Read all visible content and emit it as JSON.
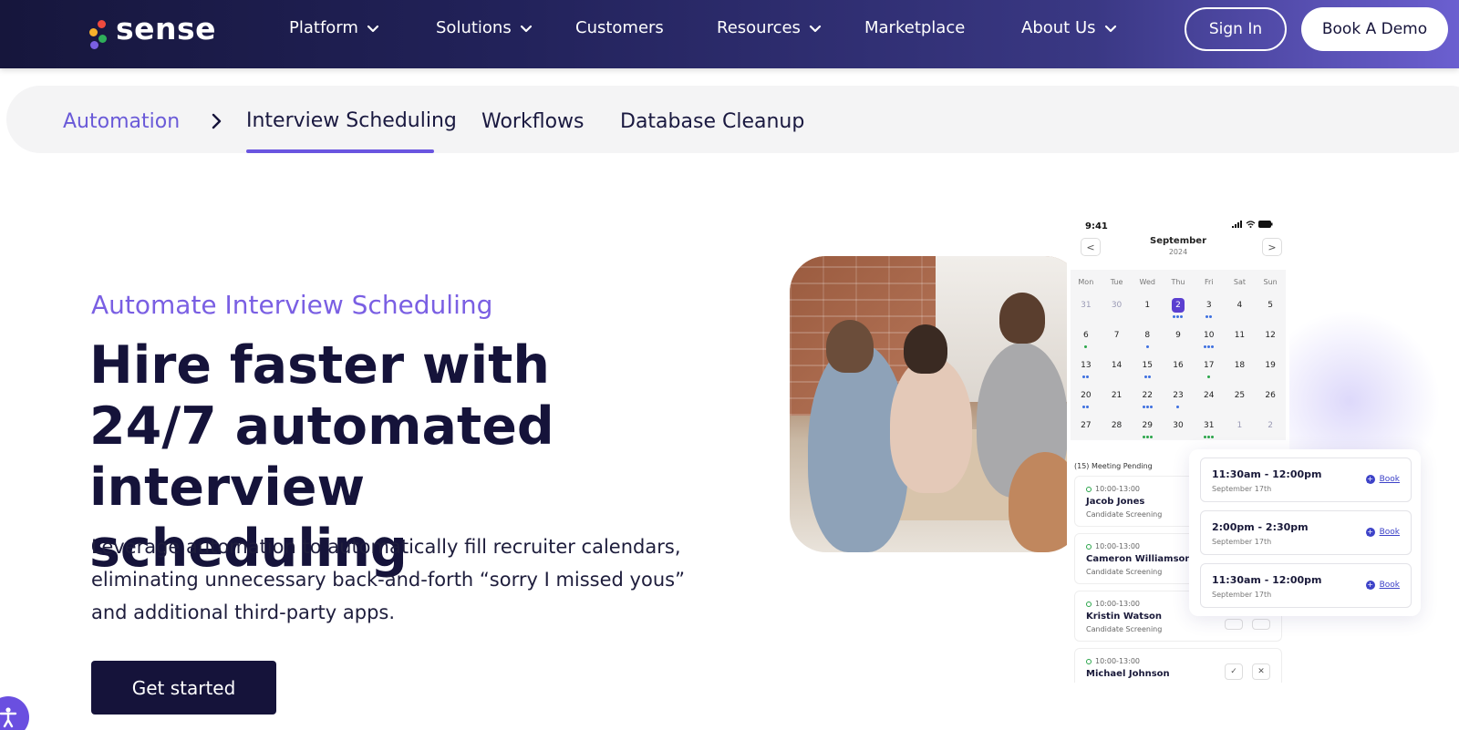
{
  "brand": {
    "name": "sense",
    "dot_colors": [
      "#f04a3e",
      "#f6b12b",
      "#2fae5a",
      "#7a5fe3"
    ]
  },
  "nav": {
    "items": [
      {
        "label": "Platform",
        "has_dropdown": true
      },
      {
        "label": "Solutions",
        "has_dropdown": true
      },
      {
        "label": "Customers",
        "has_dropdown": false
      },
      {
        "label": "Resources",
        "has_dropdown": true
      },
      {
        "label": "Marketplace",
        "has_dropdown": false
      },
      {
        "label": "About Us",
        "has_dropdown": true
      }
    ],
    "sign_in": "Sign In",
    "book_demo": "Book A Demo"
  },
  "subnav": {
    "root": "Automation",
    "items": [
      "Interview Scheduling",
      "Workflows",
      "Database Cleanup"
    ],
    "active_index": 0
  },
  "hero": {
    "eyebrow": "Automate Interview Scheduling",
    "title": "Hire faster with 24/7 automated interview scheduling",
    "description": "Leverage automation to automatically fill recruiter calendars, eliminating unnecessary back-and-forth “sorry I missed yous” and additional third-party apps.",
    "cta": "Get started"
  },
  "phone": {
    "time": "9:41",
    "month": "September",
    "year": "2024",
    "prev": "<",
    "next": ">",
    "weekdays": [
      "Mon",
      "Tue",
      "Wed",
      "Thu",
      "Fri",
      "Sat",
      "Sun"
    ],
    "weeks": [
      [
        "31",
        "30",
        "1",
        "2",
        "3",
        "4",
        "5"
      ],
      [
        "6",
        "7",
        "8",
        "9",
        "10",
        "11",
        "12"
      ],
      [
        "13",
        "14",
        "15",
        "16",
        "17",
        "18",
        "19"
      ],
      [
        "20",
        "21",
        "22",
        "23",
        "24",
        "25",
        "26"
      ],
      [
        "27",
        "28",
        "29",
        "30",
        "31",
        "1",
        "2"
      ]
    ],
    "selected_day": "2",
    "pending_label": "(15) Meeting Pending",
    "meetings": [
      {
        "time": "10:00-13:00",
        "name": "Jacob Jones",
        "type": "Candidate Screening"
      },
      {
        "time": "10:00-13:00",
        "name": "Cameron Williamson",
        "type": "Candidate Screening"
      },
      {
        "time": "10:00-13:00",
        "name": "Kristin Watson",
        "type": "Candidate Screening"
      },
      {
        "time": "10:00-13:00",
        "name": "Michael Johnson",
        "type": ""
      }
    ]
  },
  "slots": [
    {
      "time": "11:30am - 12:00pm",
      "date": "September 17th",
      "action": "Book"
    },
    {
      "time": "2:00pm - 2:30pm",
      "date": "September 17th",
      "action": "Book"
    },
    {
      "time": "11:30am - 12:00pm",
      "date": "September 17th",
      "action": "Book"
    }
  ],
  "colors": {
    "accent": "#6a55e0",
    "dark": "#15133a"
  }
}
